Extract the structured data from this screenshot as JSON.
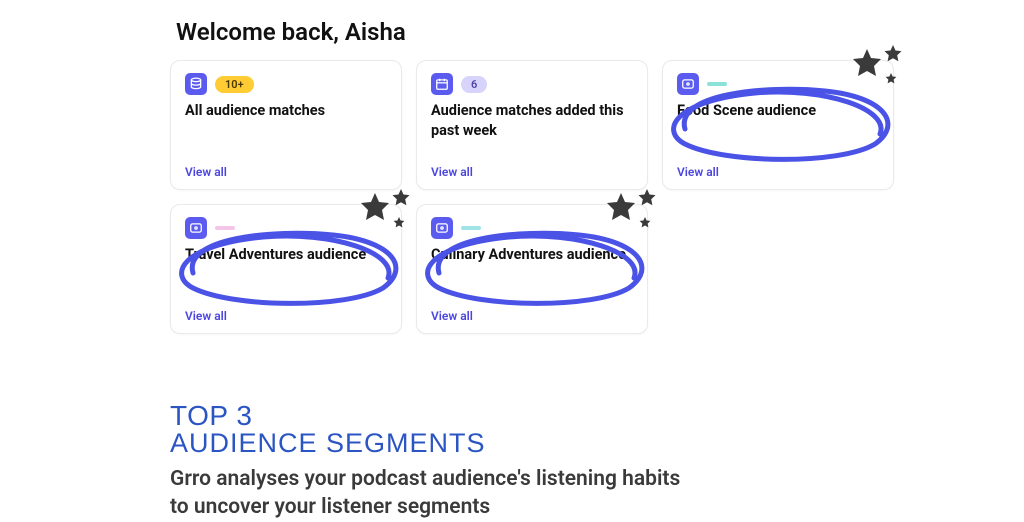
{
  "welcome": "Welcome back, Aisha",
  "cards": [
    {
      "badge": "10+",
      "title": "All audience matches",
      "link": "View all"
    },
    {
      "badge": "6",
      "title": "Audience matches added this past week",
      "link": "View all"
    },
    {
      "badge": "",
      "title": "Food Scene audience",
      "link": "View all"
    },
    {
      "badge": "",
      "title": "Travel Adventures audience",
      "link": "View all"
    },
    {
      "badge": "",
      "title": "Culinary Adventures audience",
      "link": "View all"
    }
  ],
  "section": {
    "top3": "TOP 3",
    "heading": "AUDIENCE SEGMENTS",
    "blurb": "Grro analyses your podcast audience's listening habits to uncover your listener segments"
  }
}
